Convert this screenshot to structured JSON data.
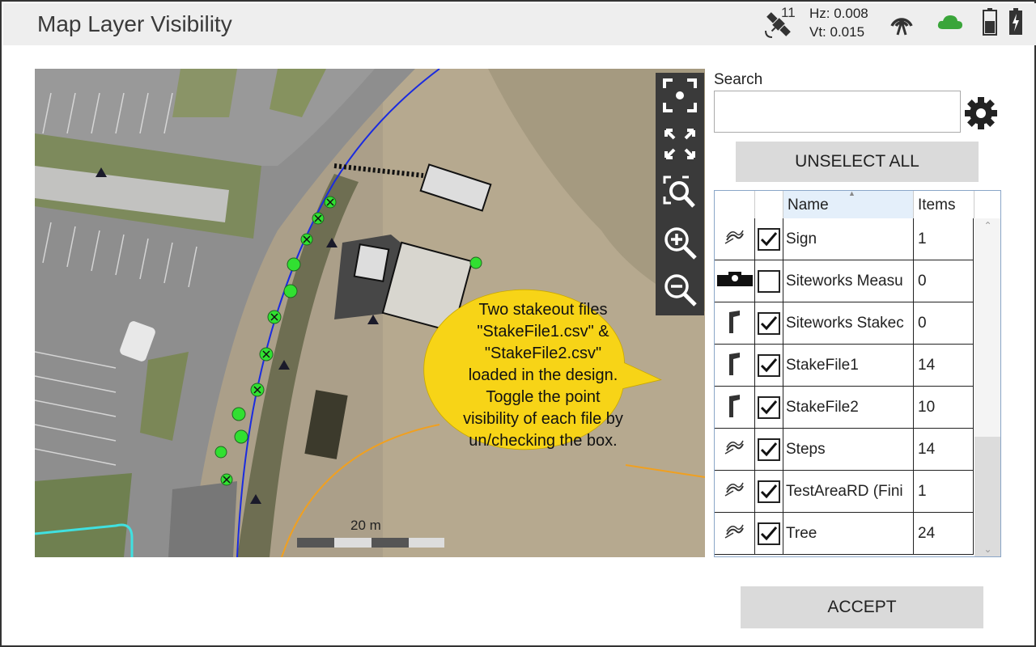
{
  "header": {
    "title": "Map Layer Visibility",
    "satellite_count": "11",
    "hz": "Hz: 0.008",
    "vt": "Vt: 0.015",
    "icons": [
      "satellite-icon",
      "radio-signal-icon",
      "cloud-icon",
      "battery-icon",
      "power-icon"
    ],
    "cloud_color": "#3aa53a"
  },
  "map": {
    "scale_label": "20 m",
    "tools": [
      "zoom-extents-icon",
      "fit-to-screen-icon",
      "zoom-to-selection-icon",
      "zoom-in-icon",
      "zoom-out-icon"
    ],
    "callout": [
      "Two stakeout files",
      "\"StakeFile1.csv\" &",
      "\"StakeFile2.csv\"",
      "loaded in the design.",
      "Toggle the point",
      "visibility of each file by",
      "un/checking the box."
    ],
    "callout_color": "#f7d417"
  },
  "search": {
    "label": "Search",
    "value": "",
    "placeholder": ""
  },
  "unselect_all_label": "UNSELECT ALL",
  "table": {
    "columns": {
      "name": "Name",
      "items": "Items"
    },
    "rows": [
      {
        "icon": "point-code-icon",
        "checked": true,
        "name": "Sign",
        "items": "1"
      },
      {
        "icon": "measure-instrument-icon",
        "checked": false,
        "name": "Siteworks Measu",
        "items": "0"
      },
      {
        "icon": "stake-flag-icon",
        "checked": true,
        "name": "Siteworks Stakec",
        "items": "0"
      },
      {
        "icon": "stake-flag-icon",
        "checked": true,
        "name": "StakeFile1",
        "items": "14"
      },
      {
        "icon": "stake-flag-icon",
        "checked": true,
        "name": "StakeFile2",
        "items": "10"
      },
      {
        "icon": "point-code-icon",
        "checked": true,
        "name": "Steps",
        "items": "14"
      },
      {
        "icon": "point-code-icon",
        "checked": true,
        "name": "TestAreaRD (Fini",
        "items": "1"
      },
      {
        "icon": "point-code-icon",
        "checked": true,
        "name": "Tree",
        "items": "24"
      }
    ]
  },
  "accept_label": "ACCEPT"
}
